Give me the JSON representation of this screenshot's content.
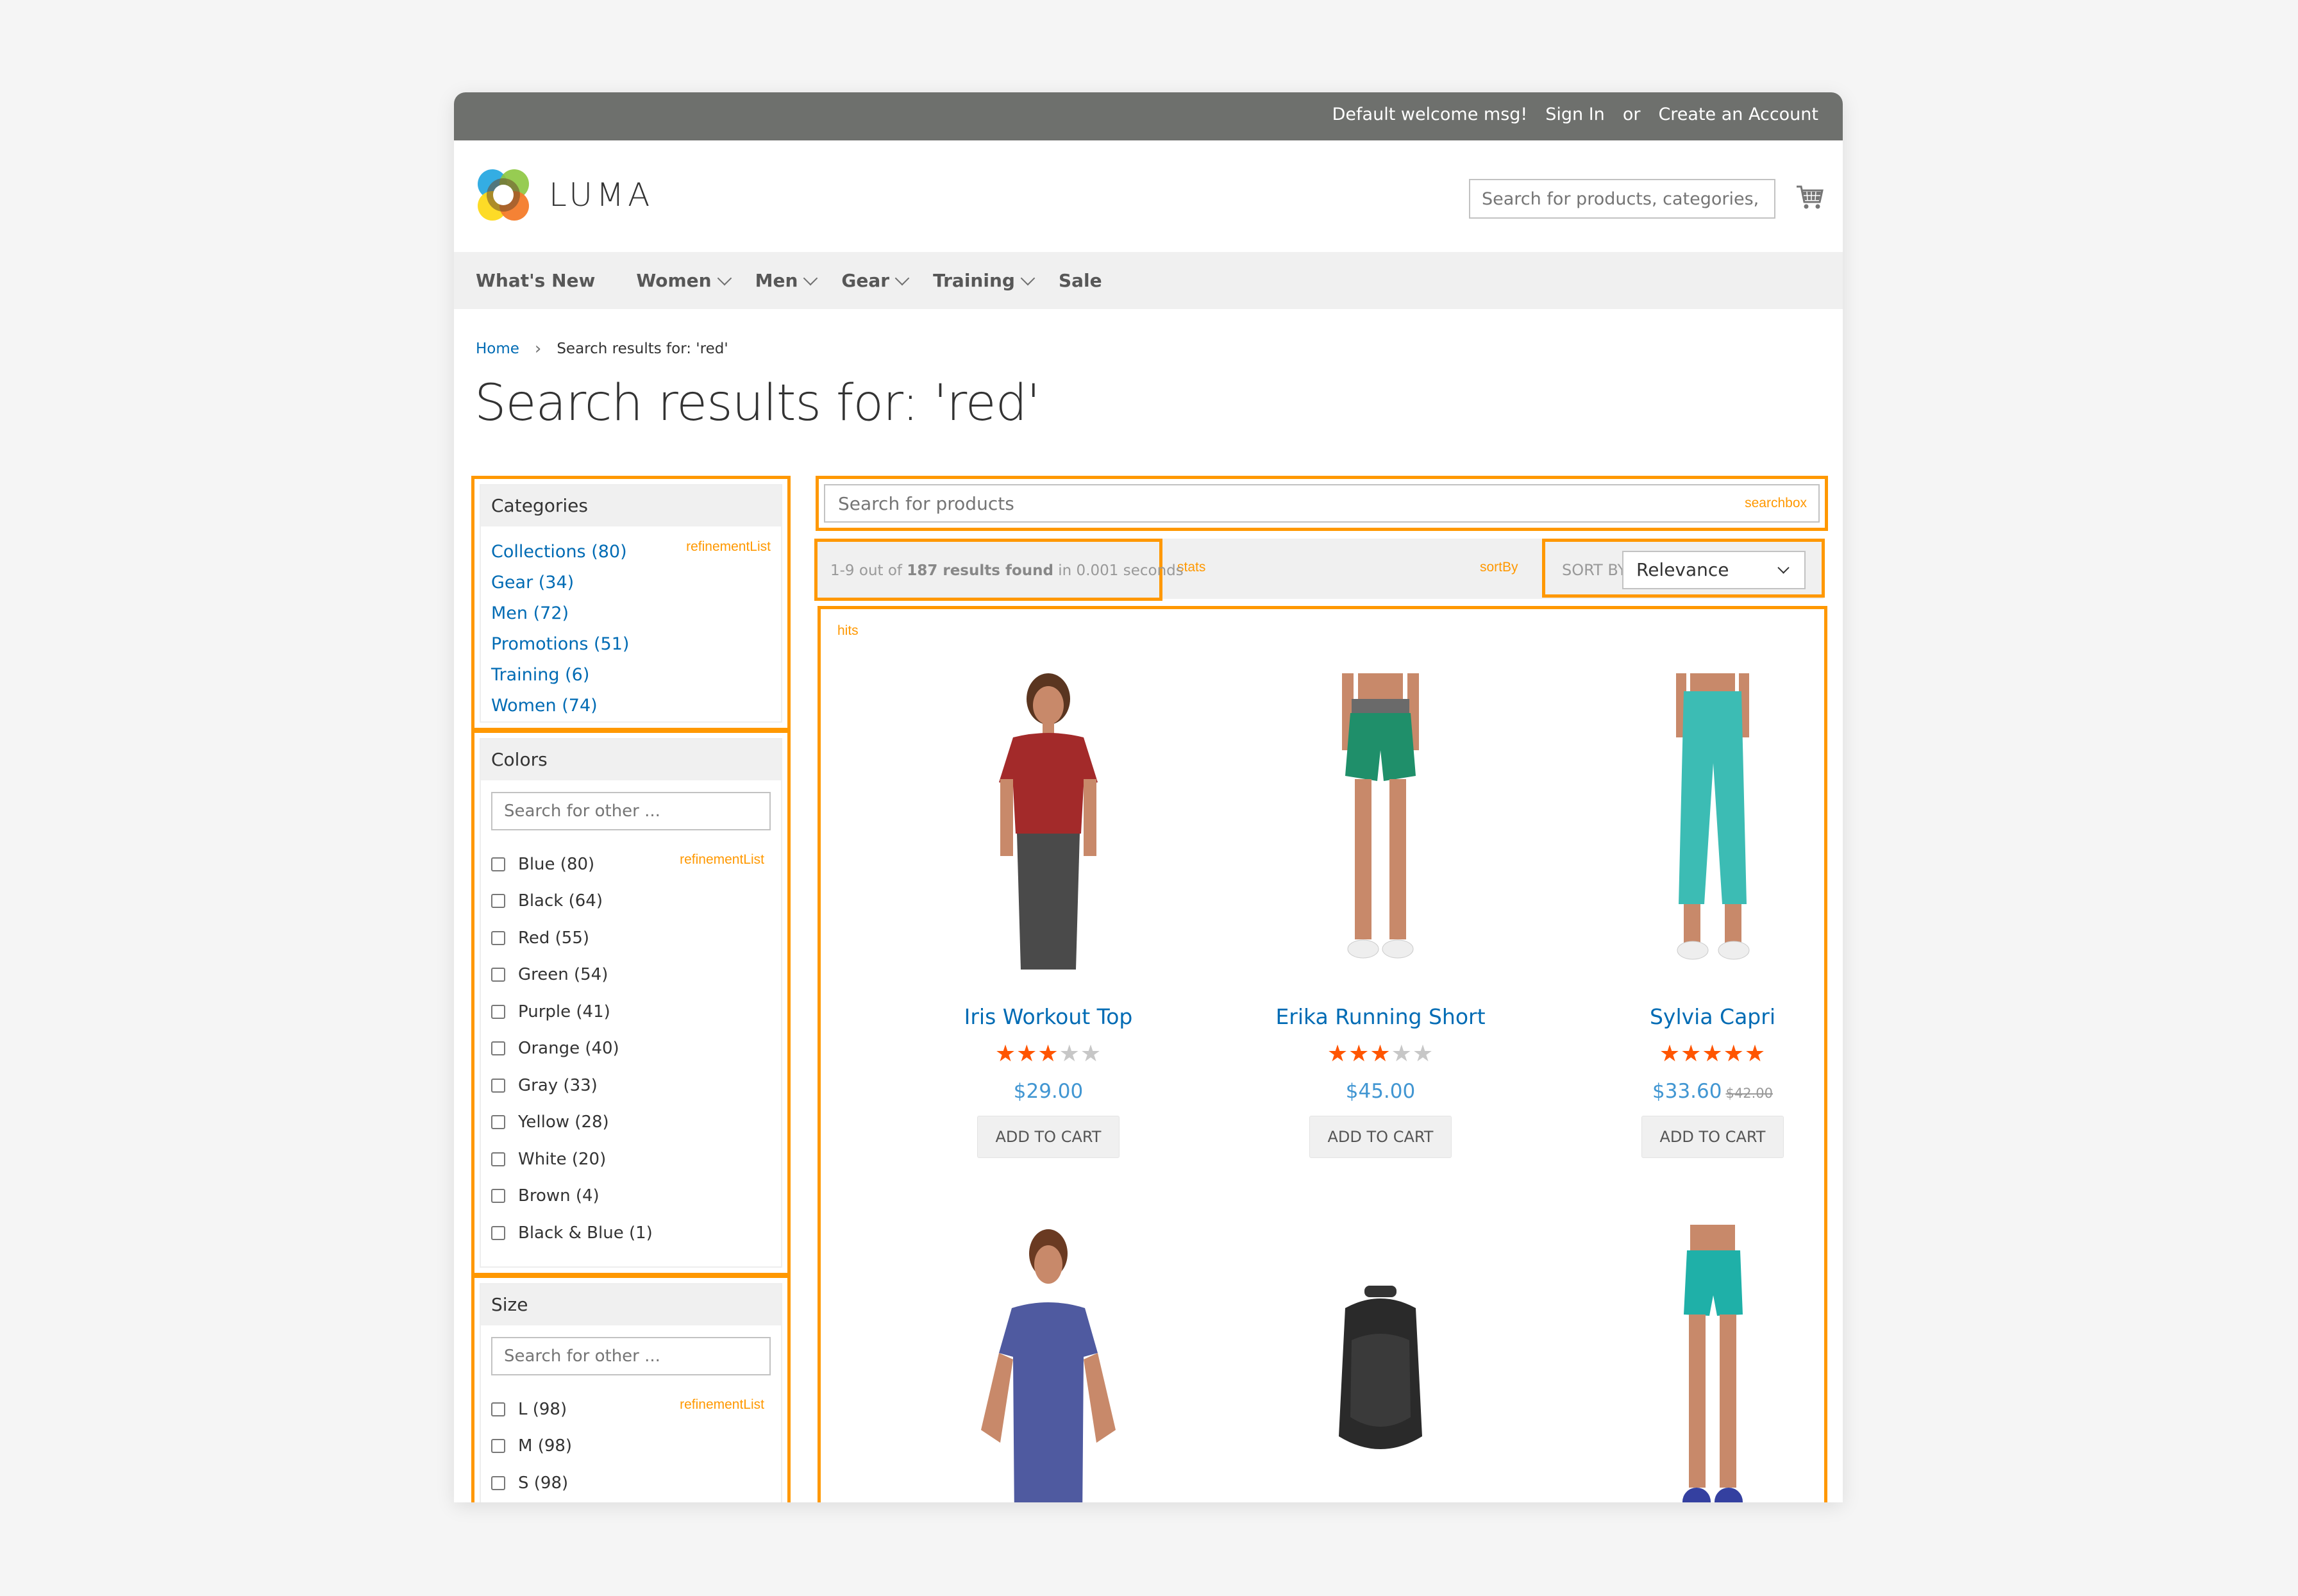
{
  "topbar": {
    "welcome": "Default welcome msg!",
    "sign_in": "Sign In",
    "or": "or",
    "create_account": "Create an Account"
  },
  "header": {
    "logo_text": "LUMA",
    "search_placeholder": "Search for products, categories,",
    "cart_icon": "shopping-cart-icon"
  },
  "nav": {
    "items": [
      {
        "label": "What's New",
        "dropdown": false
      },
      {
        "label": "Women",
        "dropdown": true
      },
      {
        "label": "Men",
        "dropdown": true
      },
      {
        "label": "Gear",
        "dropdown": true
      },
      {
        "label": "Training",
        "dropdown": true
      },
      {
        "label": "Sale",
        "dropdown": false
      }
    ]
  },
  "breadcrumb": {
    "home": "Home",
    "separator": "›",
    "current": "Search results for: 'red'"
  },
  "page_title": "Search results for: 'red'",
  "widget_labels": {
    "refinement_list": "refinementList",
    "searchbox": "searchbox",
    "stats": "stats",
    "sort_by": "sortBy",
    "hits": "hits"
  },
  "sidebar": {
    "categories": {
      "title": "Categories",
      "items": [
        {
          "label": "Collections (80)"
        },
        {
          "label": "Gear (34)"
        },
        {
          "label": "Men (72)"
        },
        {
          "label": "Promotions (51)"
        },
        {
          "label": "Training (6)"
        },
        {
          "label": "Women (74)"
        }
      ]
    },
    "colors": {
      "title": "Colors",
      "search_placeholder": "Search for other ...",
      "items": [
        {
          "label": "Blue (80)",
          "checked": false
        },
        {
          "label": "Black (64)",
          "checked": false
        },
        {
          "label": "Red (55)",
          "checked": false
        },
        {
          "label": "Green (54)",
          "checked": false
        },
        {
          "label": "Purple (41)",
          "checked": false
        },
        {
          "label": "Orange (40)",
          "checked": false
        },
        {
          "label": "Gray (33)",
          "checked": false
        },
        {
          "label": "Yellow (28)",
          "checked": false
        },
        {
          "label": "White (20)",
          "checked": false
        },
        {
          "label": "Brown (4)",
          "checked": false
        },
        {
          "label": "Black & Blue (1)",
          "checked": false
        }
      ]
    },
    "size": {
      "title": "Size",
      "search_placeholder": "Search for other ...",
      "items": [
        {
          "label": "L (98)",
          "checked": false
        },
        {
          "label": "M (98)",
          "checked": false
        },
        {
          "label": "S (98)",
          "checked": false
        }
      ]
    }
  },
  "searchbox": {
    "placeholder": "Search for products"
  },
  "stats": {
    "prefix": "1-9 out of ",
    "count_text": "187 results found",
    "suffix": " in 0.001 seconds"
  },
  "sort": {
    "label": "SORT BY",
    "selected": "Relevance"
  },
  "products": [
    {
      "name": "Iris Workout Top",
      "rating": 3,
      "max_rating": 5,
      "price": "$29.00",
      "old_price": null,
      "button": "ADD TO CART",
      "image": "woman-red-top"
    },
    {
      "name": "Erika Running Short",
      "rating": 3,
      "max_rating": 5,
      "price": "$45.00",
      "old_price": null,
      "button": "ADD TO CART",
      "image": "green-shorts"
    },
    {
      "name": "Sylvia Capri",
      "rating": 5,
      "max_rating": 5,
      "price": "$33.60",
      "old_price": "$42.00",
      "button": "ADD TO CART",
      "image": "teal-capri"
    },
    {
      "name": "",
      "image": "woman-purple-tee"
    },
    {
      "name": "",
      "image": "black-backpack"
    },
    {
      "name": "",
      "image": "teal-shorts"
    }
  ],
  "colors": {
    "accent_orange": "#ff9800",
    "link_blue": "#006bb4",
    "price_blue": "#4196d2",
    "star_orange": "#ff5501",
    "topbar_gray": "#6e706d"
  }
}
